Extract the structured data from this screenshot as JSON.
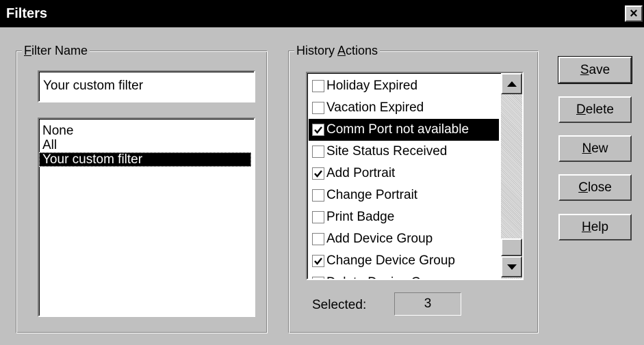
{
  "window": {
    "title": "Filters",
    "close_label": "×"
  },
  "filter_name": {
    "legend_accel": "F",
    "legend_rest": "ilter Name",
    "input_value": "Your custom filter",
    "list_items": [
      "None",
      "All",
      "Your custom filter"
    ],
    "selected_index": 2
  },
  "history_actions": {
    "legend_pre": "History ",
    "legend_accel": "A",
    "legend_rest": "ctions",
    "items": [
      {
        "label": "Holiday Expired",
        "checked": false,
        "selected": false
      },
      {
        "label": "Vacation Expired",
        "checked": false,
        "selected": false
      },
      {
        "label": "Comm Port not available",
        "checked": true,
        "selected": true
      },
      {
        "label": "Site Status Received",
        "checked": false,
        "selected": false
      },
      {
        "label": "Add Portrait",
        "checked": true,
        "selected": false
      },
      {
        "label": "Change Portrait",
        "checked": false,
        "selected": false
      },
      {
        "label": "Print Badge",
        "checked": false,
        "selected": false
      },
      {
        "label": "Add Device Group",
        "checked": false,
        "selected": false
      },
      {
        "label": "Change Device Group",
        "checked": true,
        "selected": false
      },
      {
        "label": "Delete Device Group",
        "checked": false,
        "selected": false
      }
    ],
    "selected_label": "Selected:",
    "selected_count": "3"
  },
  "buttons": {
    "save": {
      "accel": "S",
      "rest": "ave"
    },
    "delete": {
      "accel": "D",
      "rest": "elete"
    },
    "new": {
      "accel": "N",
      "rest": "ew"
    },
    "close": {
      "accel": "C",
      "rest": "lose"
    },
    "help": {
      "accel": "H",
      "rest": "elp"
    }
  },
  "colors": {
    "face": "#c0c0c0",
    "titlebar": "#000000",
    "selection": "#000000"
  }
}
